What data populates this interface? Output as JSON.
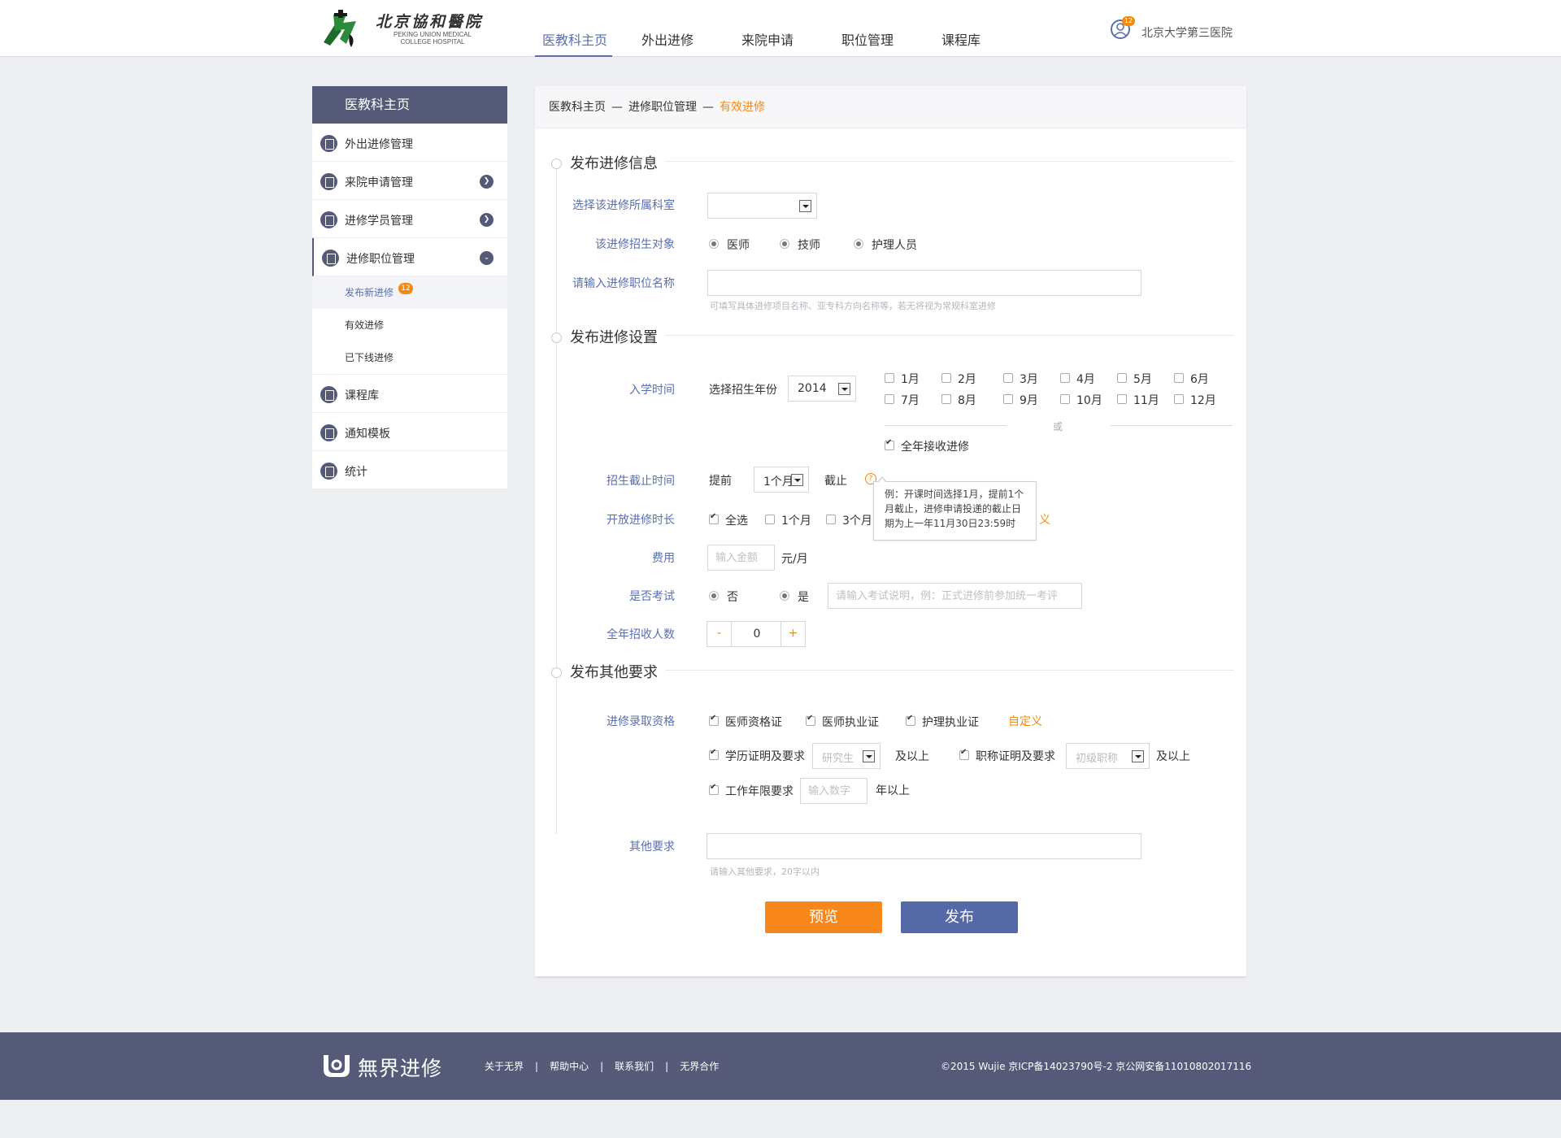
{
  "header": {
    "logo_cn": "北京協和醫院",
    "logo_en_line1": "PEKING UNION MEDICAL",
    "logo_en_line2": "COLLEGE HOSPITAL",
    "nav": [
      "医教科主页",
      "外出进修",
      "来院申请",
      "职位管理",
      "课程库"
    ],
    "active_nav": "医教科主页",
    "user_badge": "12",
    "user_name": "北京大学第三医院"
  },
  "sidebar": {
    "title": "医教科主页",
    "items": [
      "外出进修管理",
      "来院申请管理",
      "进修学员管理",
      "进修职位管理"
    ],
    "sub_items": [
      "发布新进修",
      "有效进修",
      "已下线进修"
    ],
    "sub_badge": "12",
    "items_after": [
      "课程库",
      "通知模板",
      "统计"
    ]
  },
  "breadcrumb": {
    "level1": "医教科主页",
    "level2": "进修职位管理",
    "current": "有效进修",
    "separator": "—"
  },
  "section1": {
    "title": "发布进修信息",
    "dept_label": "选择该进修所属科室",
    "dept_value": "",
    "target_label": "该进修招生对象",
    "target_options": [
      "医师",
      "技师",
      "护理人员"
    ],
    "name_label": "请输入进修职位名称",
    "name_value": "",
    "name_hint": "可填写具体进修项目名称、亚专科方向名称等，若无将视为常规科室进修"
  },
  "section2": {
    "title": "发布进修设置",
    "enroll_label": "入学时间",
    "year_label": "选择招生年份",
    "year_value": "2014",
    "months": [
      "1月",
      "2月",
      "3月",
      "4月",
      "5月",
      "6月",
      "7月",
      "8月",
      "9月",
      "10月",
      "11月",
      "12月"
    ],
    "or_text": "或",
    "all_year": "全年接收进修",
    "deadline_label": "招生截止时间",
    "deadline_before": "提前",
    "deadline_value": "1个月",
    "deadline_after": "截止",
    "tooltip": "例：开课时间选择1月，提前1个月截止，进修申请投递的截止日期为上一年11月30日23:59时",
    "duration_label": "开放进修时长",
    "duration_options": [
      "全选",
      "1个月",
      "3个月"
    ],
    "duration_custom_tail": "义",
    "fee_label": "费用",
    "fee_placeholder": "输入金额",
    "fee_unit": "元/月",
    "exam_label": "是否考试",
    "exam_options": [
      "否",
      "是"
    ],
    "exam_placeholder": "请输入考试说明，例：正式进修前参加统一考评",
    "quota_label": "全年招收人数",
    "quota_minus": "-",
    "quota_value": "0",
    "quota_plus": "+"
  },
  "section3": {
    "title": "发布其他要求",
    "qual_label": "进修录取资格",
    "qual_row1": [
      "医师资格证",
      "医师执业证",
      "护理执业证"
    ],
    "qual_custom": "自定义",
    "edu_label": "学历证明及要求",
    "edu_value": "研究生",
    "edu_suffix": "及以上",
    "title_label": "职称证明及要求",
    "title_value": "初级职称",
    "title_suffix": "及以上",
    "work_label": "工作年限要求",
    "work_placeholder": "输入数字",
    "work_suffix": "年以上",
    "other_label": "其他要求",
    "other_value": "",
    "other_hint": "请输入其他要求，20字以内"
  },
  "actions": {
    "preview": "预览",
    "publish": "发布"
  },
  "footer": {
    "logo_text": "無界进修",
    "links": [
      "关于无界",
      "帮助中心",
      "联系我们",
      "无界合作"
    ],
    "link_separator": "|",
    "copyright": "©2015 Wujie 京ICP备14023790号-2  京公网安备11010802017116"
  },
  "colors": {
    "brand": "#545a78",
    "accent_blue": "#5a6fae",
    "accent_orange": "#f28a10",
    "page_bg": "#eeeff3"
  },
  "icons": [
    "logo-mark-icon",
    "user-avatar-icon",
    "sidebar-document-icon",
    "chevron-right-icon",
    "chevron-down-icon",
    "question-icon",
    "dropdown-arrow-icon",
    "wujie-logo-icon"
  ]
}
